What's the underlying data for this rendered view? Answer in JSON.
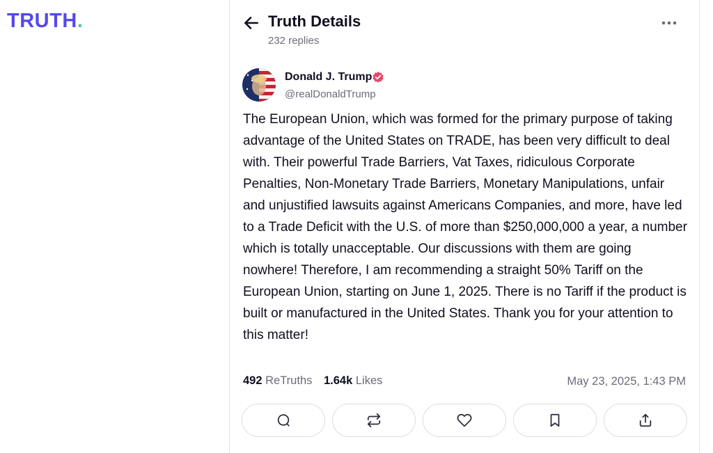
{
  "brand": {
    "logo_text": "TRUTH",
    "logo_dot": ".",
    "colors": {
      "accent": "#5448ee",
      "teal": "#45c6b8",
      "verified": "#e8476a"
    }
  },
  "header": {
    "title": "Truth Details",
    "replies": "232 replies"
  },
  "post": {
    "author_name": "Donald J. Trump",
    "handle": "@realDonaldTrump",
    "text": "The European Union, which was formed for the primary purpose of taking advantage of the United States on TRADE, has been very difficult to deal with. Their powerful Trade Barriers, Vat Taxes, ridiculous Corporate Penalties, Non-Monetary Trade Barriers, Monetary Manipulations, unfair and unjustified lawsuits against Americans Companies, and more, have led to a Trade Deficit with the U.S. of more than $250,000,000 a year, a number which is totally unacceptable. Our discussions with them are going nowhere! Therefore, I am recommending a straight 50% Tariff on the European Union, starting on June 1, 2025. There is no Tariff if the product is built or manufactured in the United States. Thank you for your attention to this matter!",
    "retruths_count": "492",
    "retruths_label": "ReTruths",
    "likes_count": "1.64k",
    "likes_label": "Likes",
    "timestamp": "May 23, 2025, 1:43 PM"
  },
  "actions": [
    {
      "icon": "reply-icon"
    },
    {
      "icon": "retruth-icon"
    },
    {
      "icon": "like-icon"
    },
    {
      "icon": "bookmark-icon"
    },
    {
      "icon": "share-icon"
    }
  ]
}
